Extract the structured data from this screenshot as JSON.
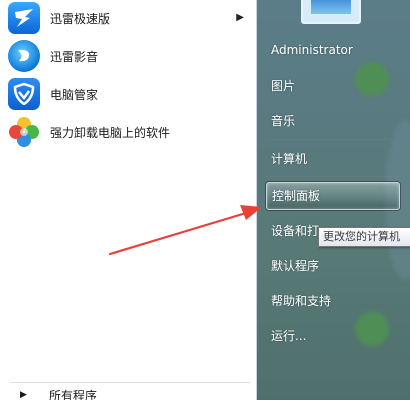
{
  "left_pane": {
    "programs": [
      {
        "label": "迅雷极速版",
        "icon": "thunder-icon",
        "has_submenu": true
      },
      {
        "label": "迅雷影音",
        "icon": "xunlei-player-icon",
        "has_submenu": false
      },
      {
        "label": "电脑管家",
        "icon": "pc-manager-icon",
        "has_submenu": false
      },
      {
        "label": "强力卸载电脑上的软件",
        "icon": "uninstall-flower-icon",
        "has_submenu": false
      }
    ],
    "all_programs": "所有程序"
  },
  "right_pane": {
    "items": [
      {
        "label": "Administrator"
      },
      {
        "label": "图片"
      },
      {
        "label": "音乐"
      },
      {
        "label": "计算机"
      },
      {
        "label": "控制面板",
        "highlighted": true
      },
      {
        "label": "设备和打"
      },
      {
        "label": "默认程序"
      },
      {
        "label": "帮助和支持"
      },
      {
        "label": "运行..."
      }
    ]
  },
  "tooltip": {
    "text": "更改您的计算机"
  },
  "colors": {
    "annotation_arrow": "#e8403a",
    "glass_pane": "#597a7e",
    "icon_blue": "#0a66d6"
  }
}
